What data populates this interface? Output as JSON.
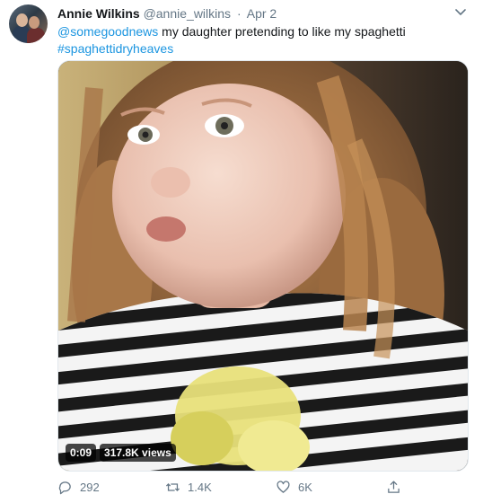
{
  "tweet": {
    "author_name": "Annie Wilkins",
    "author_handle": "@annie_wilkins",
    "separator": "·",
    "date": "Apr 2",
    "mention": "@somegoodnews",
    "text": " my daughter pretending to like my spaghetti",
    "hashtag": "#spaghettidryheaves"
  },
  "video": {
    "duration": "0:09",
    "views": "317.8K views"
  },
  "actions": {
    "replies": "292",
    "retweets": "1.4K",
    "likes": "6K"
  },
  "icons": {
    "more": "chevron-down-icon",
    "reply": "reply-icon",
    "retweet": "retweet-icon",
    "like": "heart-icon",
    "share": "share-icon"
  },
  "colors": {
    "link": "#1b95e0",
    "muted": "#657786",
    "text": "#14171a"
  }
}
